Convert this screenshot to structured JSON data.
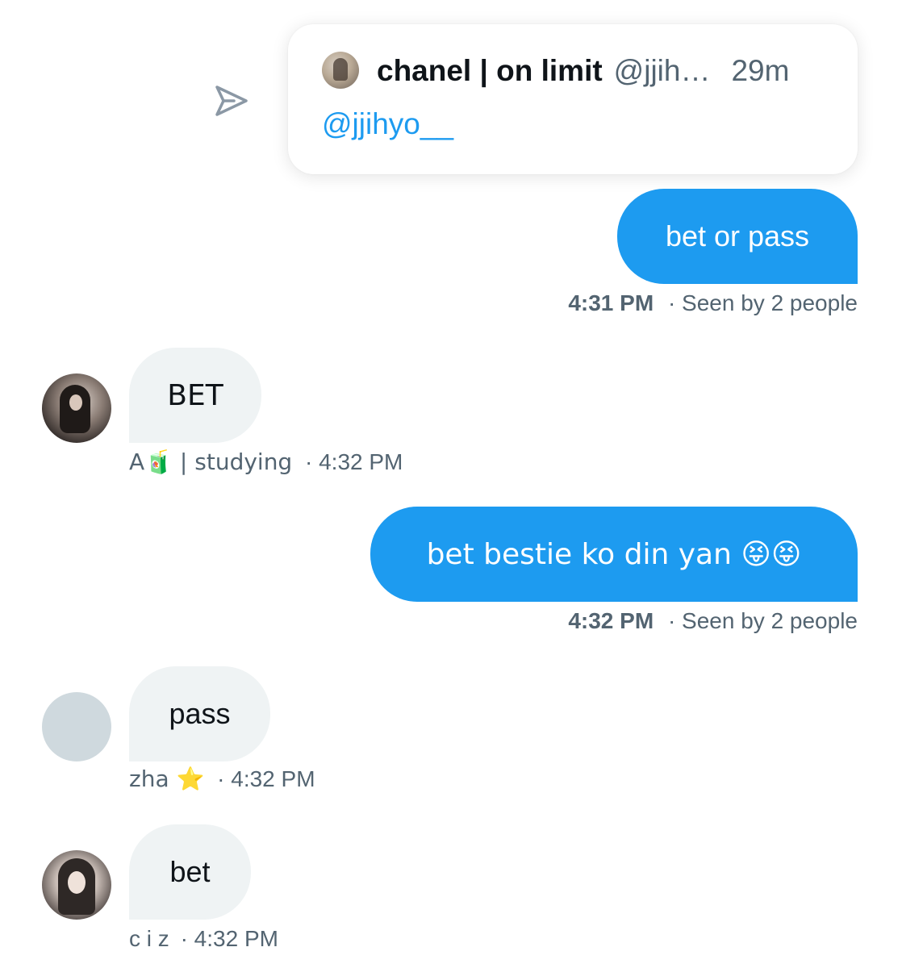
{
  "shared_tweet": {
    "author_name": "chanel | on limit",
    "author_handle": "@jjih…",
    "time_ago": "29m",
    "text": "@jjihyo__"
  },
  "messages": [
    {
      "direction": "outgoing",
      "text": "bet or pass",
      "time": "4:31 PM",
      "status": "· Seen by 2 people"
    },
    {
      "direction": "incoming",
      "text": "BET",
      "sender": "A🧃 | studying",
      "time": "· 4:32 PM"
    },
    {
      "direction": "outgoing",
      "text": "bet bestie ko din yan 😝😝",
      "time": "4:32 PM",
      "status": "· Seen by 2 people"
    },
    {
      "direction": "incoming",
      "text": "pass",
      "sender": "zha ⭐",
      "time": "· 4:32 PM"
    },
    {
      "direction": "incoming",
      "text": "bet",
      "sender": "c i z",
      "time": "· 4:32 PM"
    }
  ],
  "icons": {
    "share": "send-icon"
  },
  "colors": {
    "accent": "#1d9bf0",
    "incoming_bubble": "#eff3f4",
    "secondary_text": "#536471"
  }
}
